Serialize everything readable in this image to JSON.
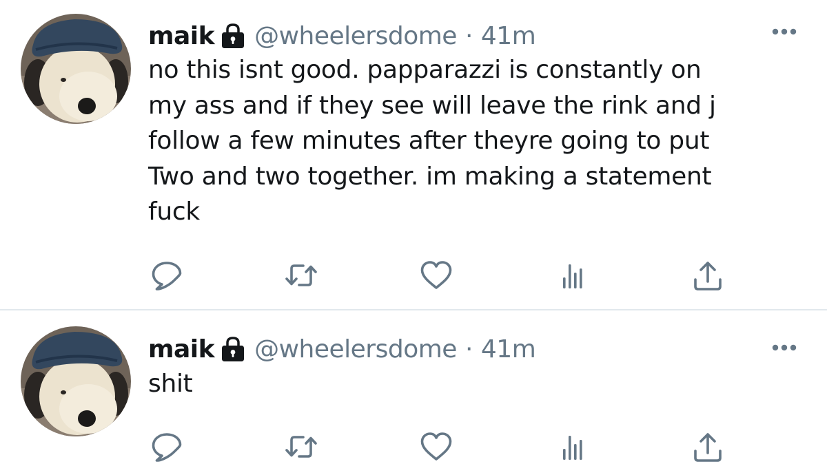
{
  "colors": {
    "text_primary": "#14171a",
    "text_secondary": "#657786",
    "icon": "#657786",
    "divider": "#e1e8ed"
  },
  "tweets": [
    {
      "display_name": "maik",
      "handle": "@wheelersdome",
      "separator": "·",
      "time": "41m",
      "protected_icon": "lock-icon",
      "text": "no this isnt good. papparazzi is constantly on\nmy ass and if they see will leave the rink and j\nfollow a few minutes after theyre going to put\nTwo and two together. im making a statement\nfuck",
      "actions": [
        "reply-icon",
        "retweet-icon",
        "like-icon",
        "analytics-icon",
        "share-icon"
      ]
    },
    {
      "display_name": "maik",
      "handle": "@wheelersdome",
      "separator": "·",
      "time": "41m",
      "protected_icon": "lock-icon",
      "text": "shit",
      "actions": [
        "reply-icon",
        "retweet-icon",
        "like-icon",
        "analytics-icon",
        "share-icon"
      ]
    }
  ]
}
